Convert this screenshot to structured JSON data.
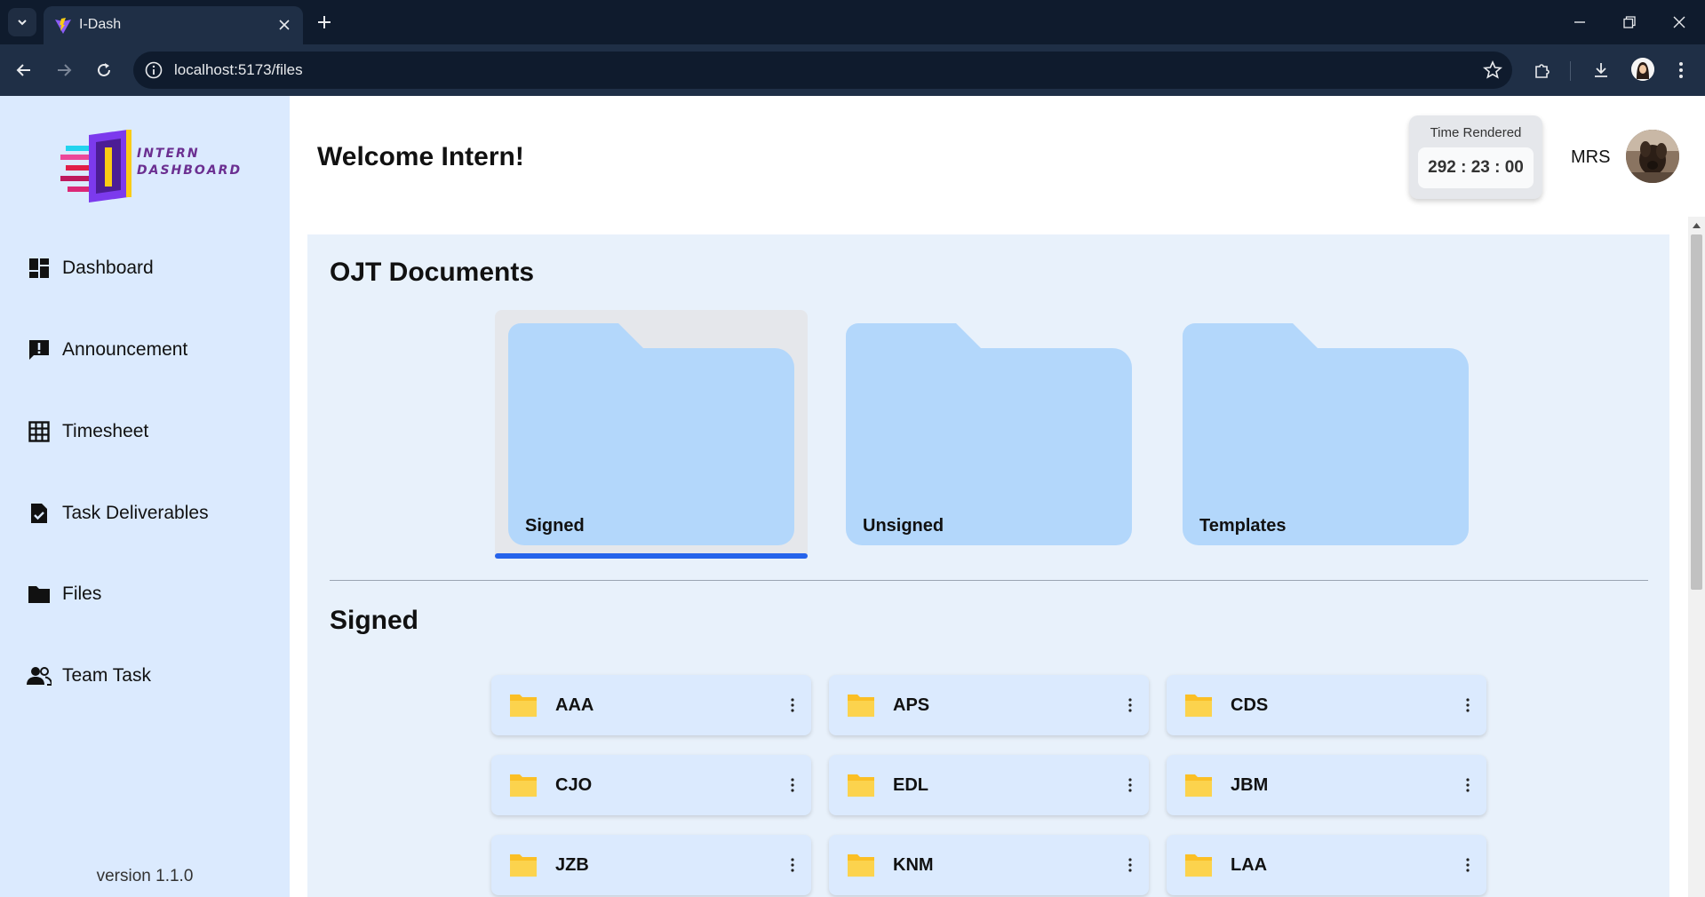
{
  "browser": {
    "tab_title": "I-Dash",
    "url": "localhost:5173/files"
  },
  "sidebar": {
    "logo_line1": "INTERN",
    "logo_line2": "DASHBOARD",
    "items": [
      {
        "label": "Dashboard",
        "icon": "dashboard-icon"
      },
      {
        "label": "Announcement",
        "icon": "announcement-icon"
      },
      {
        "label": "Timesheet",
        "icon": "timesheet-icon"
      },
      {
        "label": "Task Deliverables",
        "icon": "task-deliverables-icon"
      },
      {
        "label": "Files",
        "icon": "folder-icon"
      },
      {
        "label": "Team Task",
        "icon": "team-icon"
      }
    ],
    "version": "version 1.1.0"
  },
  "header": {
    "welcome": "Welcome Intern!",
    "time_label": "Time Rendered",
    "time_value": "292 : 23 : 00",
    "user_initials": "MRS"
  },
  "main": {
    "section_title": "OJT Documents",
    "folders": [
      {
        "label": "Signed",
        "active": true
      },
      {
        "label": "Unsigned",
        "active": false
      },
      {
        "label": "Templates",
        "active": false
      }
    ],
    "subsection_title": "Signed",
    "files": [
      "AAA",
      "APS",
      "CDS",
      "CJO",
      "EDL",
      "JBM",
      "JZB",
      "KNM",
      "LAA"
    ]
  },
  "colors": {
    "sidebar_bg": "#dbeafe",
    "content_bg": "#e8f1fb",
    "folder_blue": "#b3d7fb",
    "file_folder_yellow": "#fbbf24",
    "active_underline": "#2563eb"
  }
}
